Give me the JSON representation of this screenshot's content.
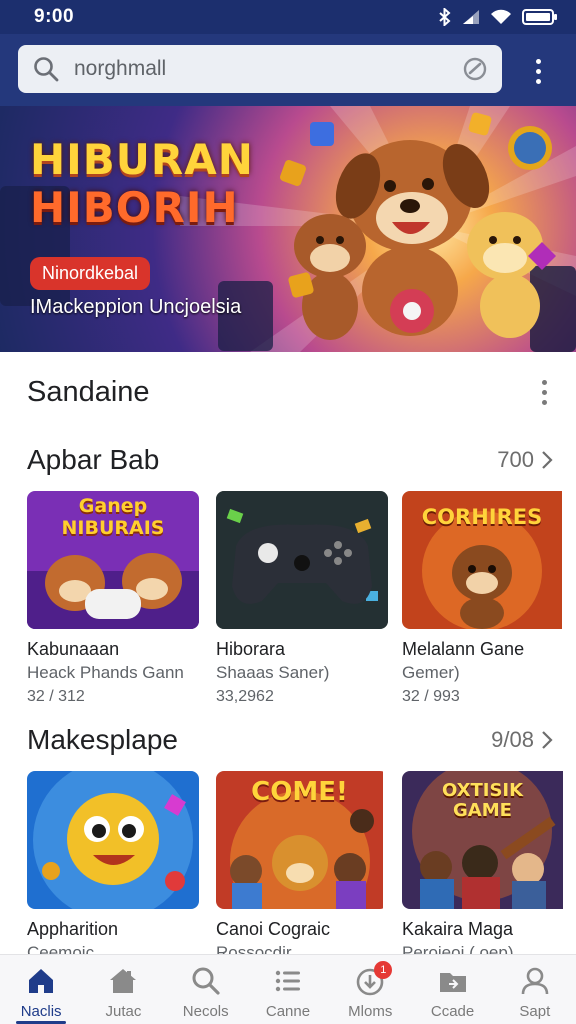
{
  "status_bar": {
    "time": "9:00"
  },
  "search": {
    "value": "norghmall"
  },
  "banner": {
    "title_line1": "HIBURAN",
    "title_line2": "HIBORIH",
    "badge": "Ninordkebal",
    "subtitle": "IMackeppion Uncjoelsia"
  },
  "section_top": {
    "title": "Sandaine"
  },
  "section1": {
    "title": "Apbar Bab",
    "more": "700",
    "cards": [
      {
        "name": "Kabunaaan",
        "genre": "Heack Phands Gann",
        "count": "32 / 312",
        "thumb_text": "Ganep NIBURAIS"
      },
      {
        "name": "Hiborara",
        "genre": "Shaaas Saner)",
        "count": "33,2962",
        "thumb_text": ""
      },
      {
        "name": "Melalann Gane",
        "genre": "Gemer)",
        "count": "32 / 993",
        "thumb_text": "CORHIRES"
      }
    ]
  },
  "section2": {
    "title": "Makesplape",
    "more": "9/08",
    "cards": [
      {
        "name": "Appharition",
        "genre": "Ceemoic",
        "thumb_text": ""
      },
      {
        "name": "Canoi Cograic",
        "genre": "Rossocdir",
        "thumb_text": "COME!"
      },
      {
        "name": "Kakaira Maga",
        "genre": "Peroieoi ( oep)",
        "thumb_text": "OXTISIK GAME"
      }
    ]
  },
  "nav": {
    "items": [
      {
        "label": "Naclis",
        "icon": "home-icon"
      },
      {
        "label": "Jutac",
        "icon": "house-icon"
      },
      {
        "label": "Necols",
        "icon": "search-icon"
      },
      {
        "label": "Canne",
        "icon": "list-icon"
      },
      {
        "label": "Mloms",
        "icon": "download-icon",
        "badge": "1"
      },
      {
        "label": "Ccade",
        "icon": "folder-icon"
      },
      {
        "label": "Sapt",
        "icon": "person-icon"
      }
    ]
  },
  "colors": {
    "header": "#24387c",
    "accent": "#1f3c8a",
    "badge": "#d9342b"
  }
}
